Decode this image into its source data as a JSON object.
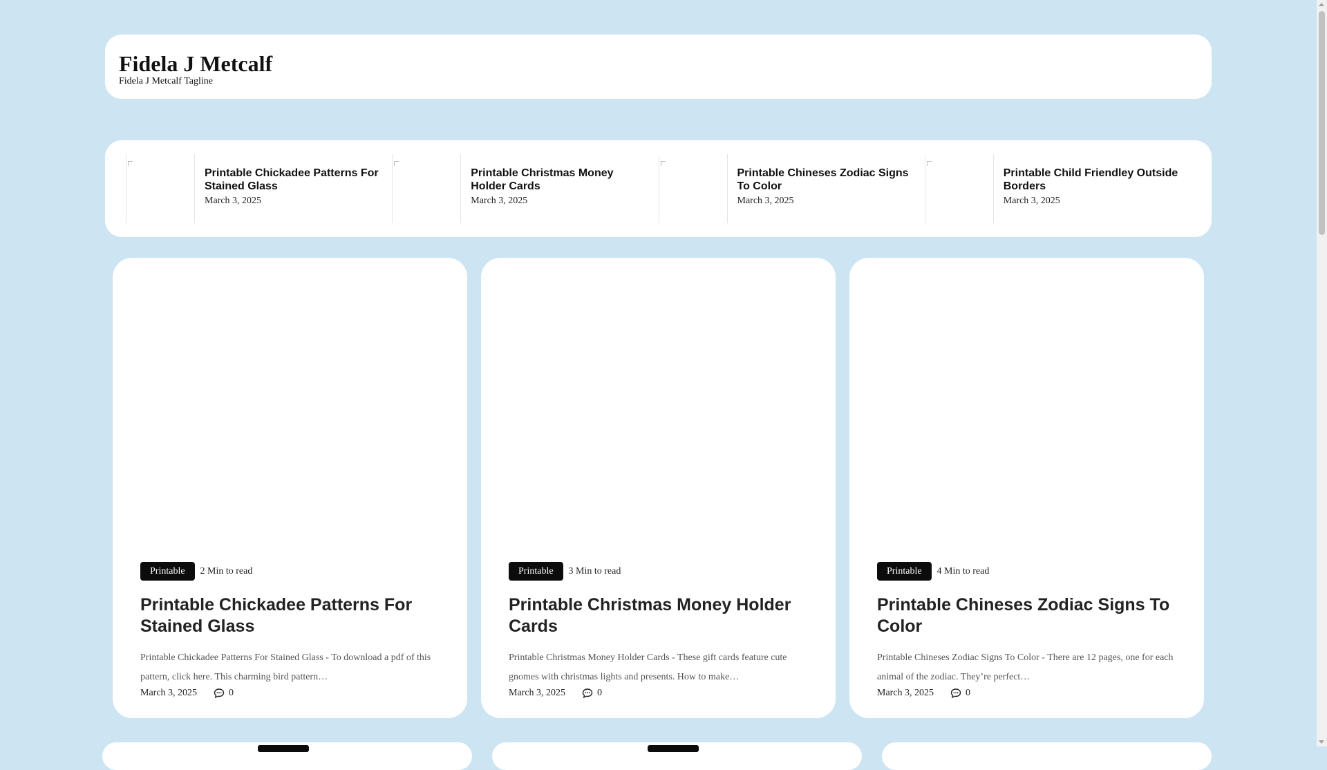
{
  "header": {
    "site_title": "Fidela J Metcalf",
    "tagline": "Fidela J Metcalf Tagline"
  },
  "recent_posts": [
    {
      "title": "Printable Chickadee Patterns For Stained Glass",
      "date": "March 3, 2025"
    },
    {
      "title": "Printable Christmas Money Holder Cards",
      "date": "March 3, 2025"
    },
    {
      "title": "Printable Chineses Zodiac Signs To Color",
      "date": "March 3, 2025"
    },
    {
      "title": "Printable Child Friendley Outside Borders",
      "date": "March 3, 2025"
    }
  ],
  "cards": [
    {
      "category": "Printable",
      "read_time": "2 Min to read",
      "title": "Printable Chickadee Patterns For Stained Glass",
      "excerpt": "Printable Chickadee Patterns For Stained Glass - To download a pdf of this pattern, click here. This charming bird pattern…",
      "date": "March 3, 2025",
      "comments": "0"
    },
    {
      "category": "Printable",
      "read_time": "3 Min to read",
      "title": "Printable Christmas Money Holder Cards",
      "excerpt": "Printable Christmas Money Holder Cards - These gift cards feature cute gnomes with christmas lights and presents. How to make…",
      "date": "March 3, 2025",
      "comments": "0"
    },
    {
      "category": "Printable",
      "read_time": "4 Min to read",
      "title": "Printable Chineses Zodiac Signs To Color",
      "excerpt": "Printable Chineses Zodiac Signs To Color - There are 12 pages, one for each animal of the zodiac. They’re perfect…",
      "date": "March 3, 2025",
      "comments": "0"
    }
  ],
  "icons": {
    "comment": "comment-icon",
    "thumbnail": "broken-image-icon"
  },
  "colors": {
    "background": "#cde4f3",
    "card": "#ffffff",
    "badge": "#0c0c0c"
  }
}
